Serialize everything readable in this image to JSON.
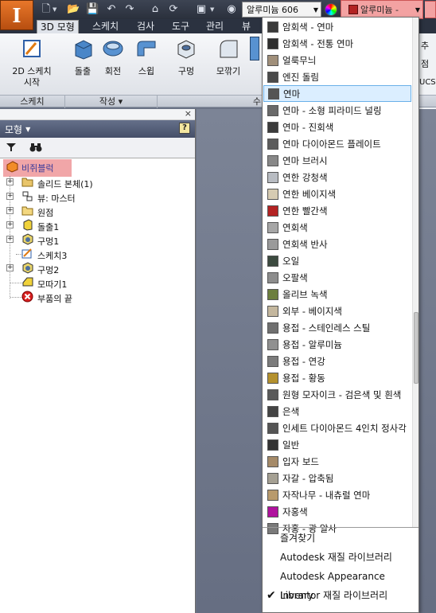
{
  "qat": {
    "material_value": "알루미늄 606",
    "appearance_value": "알루미늄 -"
  },
  "tabs": [
    {
      "label": "3D 모형"
    },
    {
      "label": "스케치"
    },
    {
      "label": "검사"
    },
    {
      "label": "도구"
    },
    {
      "label": "관리"
    },
    {
      "label": "뷰"
    }
  ],
  "ribbon": {
    "sketch2d": "2D 스케치\n시작",
    "extrude": "돌출",
    "revolve": "회전",
    "sweep": "스윕",
    "hole": "구멍",
    "fillet": "모깎기",
    "panels": [
      "스케치",
      "작성 ▾",
      "수"
    ]
  },
  "right_edge": [
    "추",
    "점",
    "UCS"
  ],
  "browser": {
    "title": "모형",
    "help": "?",
    "close": "×",
    "root": "비쥐블럭",
    "tree": [
      {
        "label": "솔리드 본체(1)"
      },
      {
        "label": "뷰: 마스터"
      },
      {
        "label": "원점"
      },
      {
        "label": "돌출1"
      },
      {
        "label": "구멍1"
      },
      {
        "label": "스케치3"
      },
      {
        "label": "구멍2"
      },
      {
        "label": "모따기1"
      },
      {
        "label": "부품의 끝"
      }
    ]
  },
  "dropdown": {
    "items": [
      {
        "label": "암회색 - 연마",
        "color": "#3a3a3a"
      },
      {
        "label": "암회색 - 전통 연마",
        "color": "#2e2e2e"
      },
      {
        "label": "얼룩무늬",
        "color": "#a08f7a"
      },
      {
        "label": "엔진 돌림",
        "color": "#4a4a4a"
      },
      {
        "label": "연마",
        "color": "#555555"
      },
      {
        "label": "연마 - 소형 피라미드 널링",
        "color": "#6a6a6a"
      },
      {
        "label": "연마 - 진회색",
        "color": "#3b3b3b"
      },
      {
        "label": "연마 다이아몬드 플레이트",
        "color": "#5c5c5c"
      },
      {
        "label": "연마 브러시",
        "color": "#888888"
      },
      {
        "label": "연한 강청색",
        "color": "#b8bcc2"
      },
      {
        "label": "연한 베이지색",
        "color": "#d6cbb2"
      },
      {
        "label": "연한 빨간색",
        "color": "#b32323"
      },
      {
        "label": "연회색",
        "color": "#a6a6a6"
      },
      {
        "label": "연회색 반사",
        "color": "#9a9a9a"
      },
      {
        "label": "오일",
        "color": "#3c4a3f"
      },
      {
        "label": "오팔색",
        "color": "#8d8d8d"
      },
      {
        "label": "올리브 녹색",
        "color": "#6d7f3e"
      },
      {
        "label": "외부 - 베이지색",
        "color": "#c4b79e"
      },
      {
        "label": "용접 - 스테인레스 스틸",
        "color": "#707070"
      },
      {
        "label": "용접 - 알루미늄",
        "color": "#909090"
      },
      {
        "label": "용접 - 연강",
        "color": "#7b7b7b"
      },
      {
        "label": "용접 - 황동",
        "color": "#b4912e"
      },
      {
        "label": "원형 모자이크 - 검은색 및 흰색",
        "color": "#5a5a5a"
      },
      {
        "label": "은색",
        "color": "#444444"
      },
      {
        "label": "인세트 다이아몬드 4인치 정사각",
        "color": "#555555"
      },
      {
        "label": "일반",
        "color": "#333333"
      },
      {
        "label": "입자 보드",
        "color": "#a58a68"
      },
      {
        "label": "자갈 - 압축됨",
        "color": "#a5a093"
      },
      {
        "label": "자작나무 - 내츄럴 연마",
        "color": "#b89a6c"
      },
      {
        "label": "자홍색",
        "color": "#b0129e"
      },
      {
        "label": "자홍 - 광 알사",
        "color": "#7a7a7a"
      }
    ],
    "selected_label": "연마",
    "libraries": [
      {
        "label": "즐겨찾기",
        "checked": false
      },
      {
        "label": "Autodesk 재질 라이브러리",
        "checked": false
      },
      {
        "label": "Autodesk Appearance Library",
        "checked": false
      },
      {
        "label": "Inventor 재질 라이브러리",
        "checked": true
      }
    ]
  }
}
